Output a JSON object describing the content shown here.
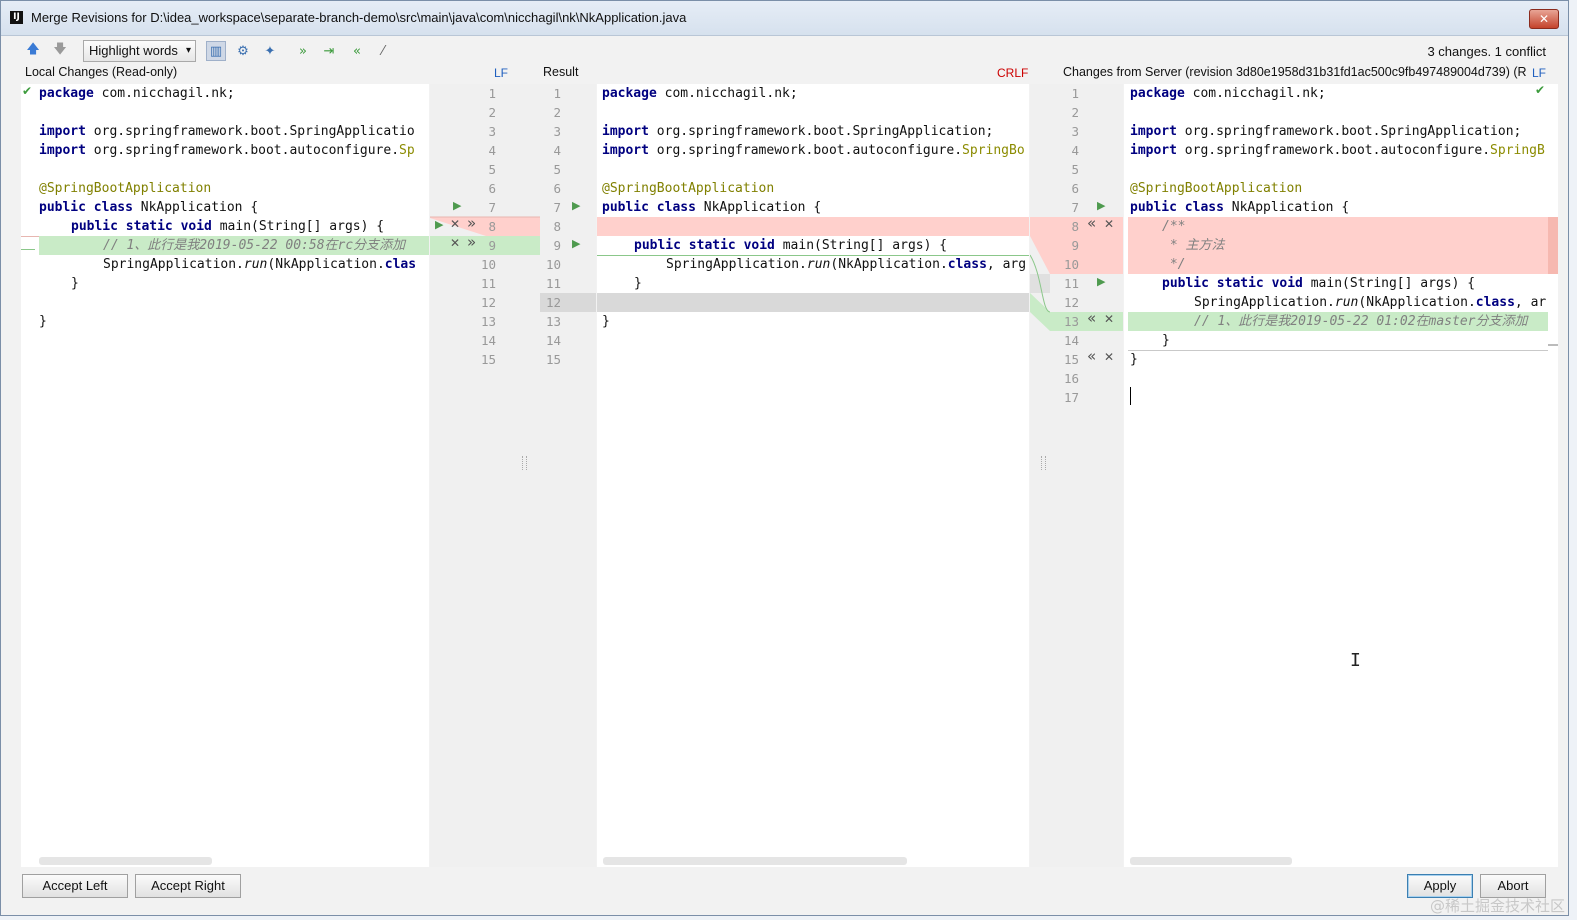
{
  "window": {
    "title": "Merge Revisions for D:\\idea_workspace\\separate-branch-demo\\src\\main\\java\\com\\nicchagil\\nk\\NkApplication.java",
    "app_icon": "intellij-icon"
  },
  "toolbar": {
    "highlight_mode": "Highlight words",
    "changes_summary": "3 changes. 1 conflict",
    "icons": [
      "arrow-up-icon",
      "arrow-down-icon",
      "columns-icon",
      "gear-icon",
      "magic-resolve-icon",
      "apply-non-conflicting-icon",
      "apply-left-icon",
      "apply-right-icon",
      "wand-icon"
    ]
  },
  "panes": {
    "left": {
      "header": "Local Changes (Read-only)",
      "line_sep": "LF"
    },
    "center": {
      "header": "Result",
      "line_sep": "CRLF"
    },
    "right": {
      "header": "Changes from Server (revision 3d80e1958d31b31fd1ac500c9fb497489004d739) (R...",
      "line_sep": "LF"
    }
  },
  "left_code": {
    "l1_kw": "package",
    "l1_rest": " com.nicchagil.nk;",
    "l3_kw": "import",
    "l3_rest": " org.springframework.boot.SpringApplicatio",
    "l4_kw": "import",
    "l4_rest": " org.springframework.boot.autoconfigure.",
    "l4_pkg": "Sp",
    "l6_ann": "@SpringBootApplication",
    "l7_kw": "public class",
    "l7_rest": " NkApplication {",
    "l8_kw": "public static void",
    "l8_rest": " main(String[] args) {",
    "l9_cmt": "// 1、此行是我2019-05-22 00:58在rc分支添加",
    "l10_a": "SpringApplication.",
    "l10_fn": "run",
    "l10_b": "(NkApplication.",
    "l10_kw": "clas",
    "l11": "}",
    "l13": "}"
  },
  "center_code": {
    "l1_kw": "package",
    "l1_rest": " com.nicchagil.nk;",
    "l3_kw": "import",
    "l3_rest": " org.springframework.boot.SpringApplication;",
    "l4_kw": "import",
    "l4_rest": " org.springframework.boot.autoconfigure.",
    "l4_pkg": "SpringBo",
    "l6_ann": "@SpringBootApplication",
    "l7_kw": "public class",
    "l7_rest": " NkApplication {",
    "l9_kw": "public static void",
    "l9_rest": " main(String[] args) {",
    "l10_a": "SpringApplication.",
    "l10_fn": "run",
    "l10_b": "(NkApplication.",
    "l10_kw": "class",
    "l10_c": ", arg",
    "l11": "}",
    "l13": "}"
  },
  "right_code": {
    "l1_kw": "package",
    "l1_rest": " com.nicchagil.nk;",
    "l3_kw": "import",
    "l3_rest": " org.springframework.boot.SpringApplication;",
    "l4_kw": "import",
    "l4_rest": " org.springframework.boot.autoconfigure.",
    "l4_pkg": "SpringB",
    "l6_ann": "@SpringBootApplication",
    "l7_kw": "public class",
    "l7_rest": " NkApplication {",
    "l8": "/**",
    "l9": " * 主方法",
    "l10": " */",
    "l11_kw": "public static void",
    "l11_rest": " main(String[] args) {",
    "l12_a": "SpringApplication.",
    "l12_fn": "run",
    "l12_b": "(NkApplication.",
    "l12_kw": "class",
    "l12_c": ", ar",
    "l13_cmt": "// 1、此行是我2019-05-22 01:02在master分支添加",
    "l14": "}",
    "l15": "}"
  },
  "line_numbers": {
    "left_gutter": [
      "1",
      "2",
      "3",
      "4",
      "5",
      "6",
      "7",
      "8",
      "9",
      "10",
      "11",
      "12",
      "13",
      "14",
      "15"
    ],
    "center_gutter": [
      "1",
      "2",
      "3",
      "4",
      "5",
      "6",
      "7",
      "8",
      "9",
      "10",
      "11",
      "12",
      "13",
      "14",
      "15"
    ],
    "right_gutter": [
      "1",
      "2",
      "3",
      "4",
      "5",
      "6",
      "7",
      "8",
      "9",
      "10",
      "11",
      "12",
      "13",
      "14",
      "15",
      "16",
      "17"
    ]
  },
  "gutter_icons": {
    "apply": "▶",
    "ignore": "✕",
    "accept_right": "»",
    "accept_left": "«",
    "check": "✔"
  },
  "buttons": {
    "accept_left": "Accept Left",
    "accept_right": "Accept Right",
    "apply": "Apply",
    "abort": "Abort"
  },
  "watermark": "@稀土掘金技术社区",
  "colors": {
    "deleted": "#ffd0cc",
    "added": "#c9ebc7",
    "keyword": "#000080",
    "annotation": "#808000",
    "comment": "#808080",
    "crlf": "#cc0000",
    "lf": "#1f5fbf"
  }
}
